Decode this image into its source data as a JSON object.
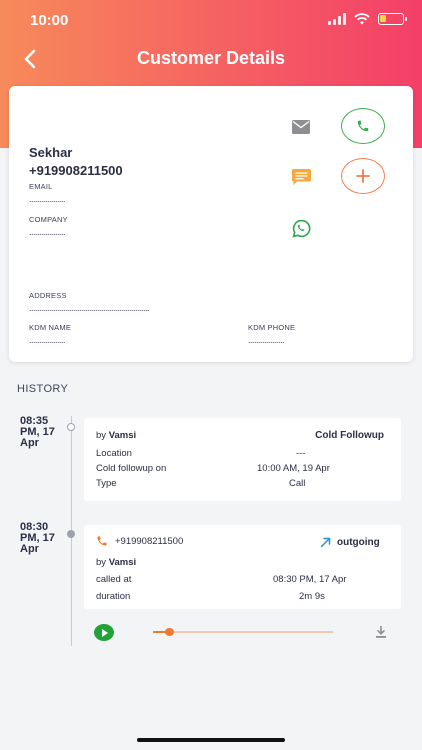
{
  "status_bar": {
    "time": "10:00",
    "battery_level": 0.3
  },
  "header": {
    "title": "Customer Details"
  },
  "customer": {
    "name": "Sekhar",
    "phone": "+919908211500",
    "email_label": "EMAIL",
    "email_value": "..................",
    "company_label": "COMPANY",
    "company_value": "..................",
    "address_label": "ADDRESS",
    "address_value": "............................................................",
    "kdm_name_label": "KDM NAME",
    "kdm_name_value": "..................",
    "kdm_phone_label": "KDM PHONE",
    "kdm_phone_value": ".................."
  },
  "history": {
    "title": "HISTORY",
    "entries": [
      {
        "timestamp": "08:35 PM, 17 Apr",
        "by_prefix": "by",
        "by_name": "Vamsi",
        "status": "Cold Followup",
        "location_label": "Location",
        "location_value": "---",
        "followup_label": "Cold followup on",
        "followup_value": "10:00 AM, 19 Apr",
        "type_label": "Type",
        "type_value": "Call"
      },
      {
        "timestamp": "08:30 PM, 17 Apr",
        "phone": "+919908211500",
        "direction": "outgoing",
        "by_prefix": "by",
        "by_name": "Vamsi",
        "called_at_label": "called at",
        "called_at_value": "08:30 PM, 17 Apr",
        "duration_label": "duration",
        "duration_value": "2m 9s",
        "playback_progress": 0.09
      }
    ]
  },
  "colors": {
    "header_start": "#f78a5a",
    "header_end": "#f43f68",
    "call_green": "#3aae4f",
    "accent_orange": "#f37a4b",
    "sms_yellow": "#f3a93b",
    "whatsapp_green": "#2aa64a",
    "outgoing_blue": "#2b8fe0"
  },
  "icons": [
    "back-arrow-icon",
    "mail-icon",
    "phone-icon",
    "message-icon",
    "plus-icon",
    "whatsapp-icon",
    "outgoing-arrow-icon",
    "play-icon",
    "download-icon"
  ]
}
